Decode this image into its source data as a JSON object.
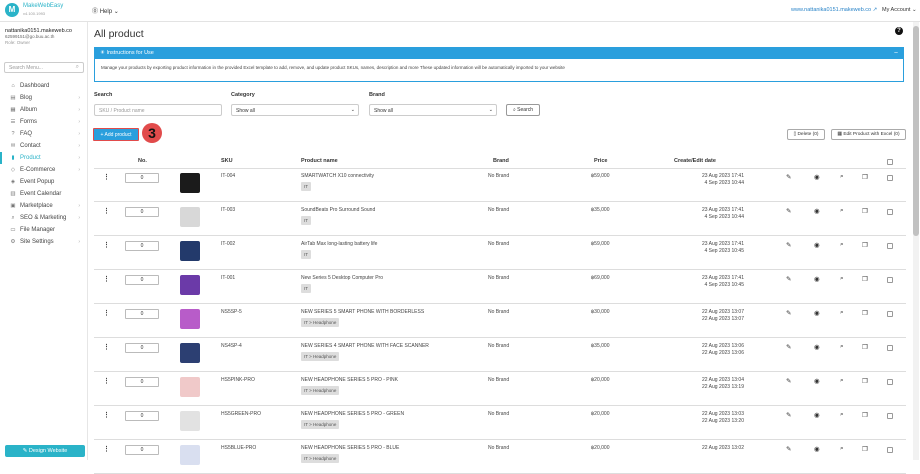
{
  "app": {
    "logo_mark": "M",
    "logo_name": "MakeWebEasy",
    "logo_version": "v4.100.1993",
    "help_label": "Help",
    "site_link": "www.nattanika0151.makeweb.co",
    "account_label": "My Account"
  },
  "user": {
    "name": "nattanika0151.makeweb.co",
    "email": "62599151@go.buu.ac.th",
    "role": "Role: Owner"
  },
  "sidebar": {
    "search_placeholder": "Search Menu...",
    "items": [
      {
        "label": "Dashboard",
        "icon": "home-icon",
        "glyph": "⌂",
        "chevron": false,
        "active": false
      },
      {
        "label": "Blog",
        "icon": "blog-icon",
        "glyph": "▤",
        "chevron": true,
        "active": false
      },
      {
        "label": "Album",
        "icon": "album-icon",
        "glyph": "▦",
        "chevron": true,
        "active": false
      },
      {
        "label": "Forms",
        "icon": "forms-icon",
        "glyph": "☰",
        "chevron": true,
        "active": false
      },
      {
        "label": "FAQ",
        "icon": "faq-icon",
        "glyph": "?",
        "chevron": true,
        "active": false
      },
      {
        "label": "Contact",
        "icon": "contact-icon",
        "glyph": "✉",
        "chevron": true,
        "active": false
      },
      {
        "label": "Product",
        "icon": "product-icon",
        "glyph": "▮",
        "chevron": true,
        "active": true
      },
      {
        "label": "E-Commerce",
        "icon": "tag-icon",
        "glyph": "◇",
        "chevron": true,
        "active": false
      },
      {
        "label": "Event Popup",
        "icon": "popup-icon",
        "glyph": "◈",
        "chevron": false,
        "active": false
      },
      {
        "label": "Event Calendar",
        "icon": "calendar-icon",
        "glyph": "▥",
        "chevron": false,
        "active": false
      },
      {
        "label": "Marketplace",
        "icon": "marketplace-icon",
        "glyph": "▣",
        "chevron": true,
        "active": false
      },
      {
        "label": "SEO & Marketing",
        "icon": "seo-icon",
        "glyph": "⌕",
        "chevron": true,
        "active": false
      },
      {
        "label": "File Manager",
        "icon": "folder-icon",
        "glyph": "▭",
        "chevron": false,
        "active": false
      },
      {
        "label": "Site Settings",
        "icon": "gear-icon",
        "glyph": "⚙",
        "chevron": true,
        "active": false
      }
    ],
    "design_button": "Design Website"
  },
  "page": {
    "title": "All product",
    "instructions_title": "Instructions for Use",
    "instructions_text": "Manage your products by exporting product information in the provided Excel template to add, remove, and update product SKUs, names, description and more These updated information will be automatically imported to your website"
  },
  "filters": {
    "search_label": "Search",
    "search_placeholder": "SKU / Product name",
    "category_label": "Category",
    "category_value": "Show all",
    "brand_label": "Brand",
    "brand_value": "Show all",
    "search_button": "Search"
  },
  "toolbar": {
    "add_product": "+ Add product",
    "step_number": "3",
    "delete_button": "Delete (0)",
    "edit_excel_button": "Edit Product with Excel (0)"
  },
  "table": {
    "headers": {
      "no": "No.",
      "sku": "SKU",
      "name": "Product name",
      "brand": "Brand",
      "price": "Price",
      "date": "Create/Edit date"
    },
    "rows": [
      {
        "no": "0",
        "sku": "IT-004",
        "name": "SMARTWATCH X10 connectivity",
        "category": "IT",
        "brand": "No Brand",
        "price": "฿59,000",
        "created": "23 Aug 2023 17:41",
        "edited": "4 Sep 2023 10:44",
        "thumb": "#1b1b1b"
      },
      {
        "no": "0",
        "sku": "IT-003",
        "name": "SoundBeats Pro Surround Sound",
        "category": "IT",
        "brand": "No Brand",
        "price": "฿35,000",
        "created": "23 Aug 2023 17:41",
        "edited": "4 Sep 2023 10:44",
        "thumb": "#d8d8d8"
      },
      {
        "no": "0",
        "sku": "IT-002",
        "name": "AirTab Max long-lasting battery life",
        "category": "IT",
        "brand": "No Brand",
        "price": "฿59,000",
        "created": "23 Aug 2023 17:41",
        "edited": "4 Sep 2023 10:45",
        "thumb": "#233a6b"
      },
      {
        "no": "0",
        "sku": "IT-001",
        "name": "New Series 5 Desktop Computer Pro",
        "category": "IT",
        "brand": "No Brand",
        "price": "฿69,000",
        "created": "23 Aug 2023 17:41",
        "edited": "4 Sep 2023 10:45",
        "thumb": "#6b3aa8"
      },
      {
        "no": "0",
        "sku": "NS5SP-5",
        "name": "NEW SERIES 5 SMART PHONE WITH BORDERLESS",
        "category": "IT > Headphone",
        "brand": "No Brand",
        "price": "฿30,000",
        "created": "22 Aug 2023 13:07",
        "edited": "22 Aug 2023 13:07",
        "thumb": "#b85cc9"
      },
      {
        "no": "0",
        "sku": "NS4SP-4",
        "name": "NEW SERIES 4 SMART PHONE WITH FACE SCANNER",
        "category": "IT > Headphone",
        "brand": "No Brand",
        "price": "฿35,000",
        "created": "22 Aug 2023 13:06",
        "edited": "22 Aug 2023 13:06",
        "thumb": "#2c3f72"
      },
      {
        "no": "0",
        "sku": "HS5PINK-PRO",
        "name": "NEW HEADPHONE SERIES 5 PRO - PINK",
        "category": "IT > Headphone",
        "brand": "No Brand",
        "price": "฿20,000",
        "created": "22 Aug 2023 13:04",
        "edited": "22 Aug 2023 13:19",
        "thumb": "#f0c9c9"
      },
      {
        "no": "0",
        "sku": "HS5GREEN-PRO",
        "name": "NEW HEADPHONE SERIES 5 PRO - GREEN",
        "category": "IT > Headphone",
        "brand": "No Brand",
        "price": "฿20,000",
        "created": "22 Aug 2023 13:03",
        "edited": "22 Aug 2023 13:20",
        "thumb": "#e2e2e2"
      },
      {
        "no": "0",
        "sku": "HS5BLUE-PRO",
        "name": "NEW HEADPHONE SERIES 5 PRO - BLUE",
        "category": "IT > Headphone",
        "brand": "No Brand",
        "price": "฿20,000",
        "created": "22 Aug 2023 13:02",
        "edited": "",
        "thumb": "#d9dff0"
      }
    ],
    "actions": [
      {
        "name": "edit-icon",
        "glyph": "✎"
      },
      {
        "name": "view-icon",
        "glyph": "◉"
      },
      {
        "name": "search-icon",
        "glyph": "⌕"
      },
      {
        "name": "copy-icon",
        "glyph": "❐"
      },
      {
        "name": "delete-icon",
        "glyph": "▯"
      }
    ]
  },
  "colors": {
    "accent": "#2ab3c8",
    "info_blue": "#2a9fdd",
    "highlight_red": "#e14b4b"
  }
}
